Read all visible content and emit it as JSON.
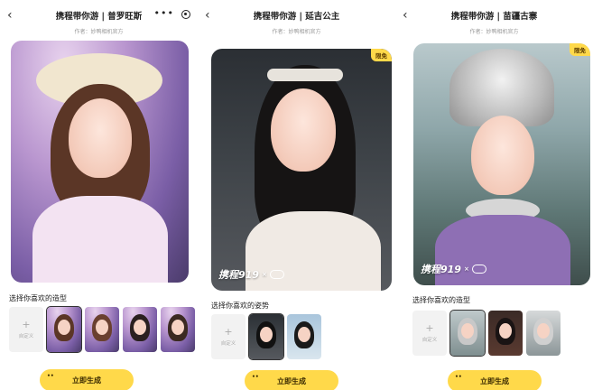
{
  "screens": [
    {
      "title": "携程带你游 | 普罗旺斯",
      "author": "作者：妙鸭相机官方",
      "badge": "",
      "watermark": "",
      "section_label": "选择你喜欢的造型",
      "custom_label": "自定义",
      "cta_label": "立即生成"
    },
    {
      "title": "携程带你游 | 延吉公主",
      "author": "作者：妙鸭相机官方",
      "badge": "限免",
      "watermark": "携程919",
      "section_label": "选择你喜欢的姿势",
      "custom_label": "自定义",
      "cta_label": "立即生成"
    },
    {
      "title": "携程带你游 | 苗疆古寨",
      "author": "作者：妙鸭相机官方",
      "badge": "限免",
      "watermark": "携程919",
      "section_label": "选择你喜欢的造型",
      "custom_label": "自定义",
      "cta_label": "立即生成"
    }
  ],
  "colors": {
    "accent": "#ffd94a",
    "text": "#222222",
    "muted": "#999999"
  },
  "icons": {
    "back": "chevron-left-icon",
    "more": "more-dots-icon",
    "target": "target-icon",
    "plus": "plus-icon",
    "cloud": "cloud-icon"
  }
}
